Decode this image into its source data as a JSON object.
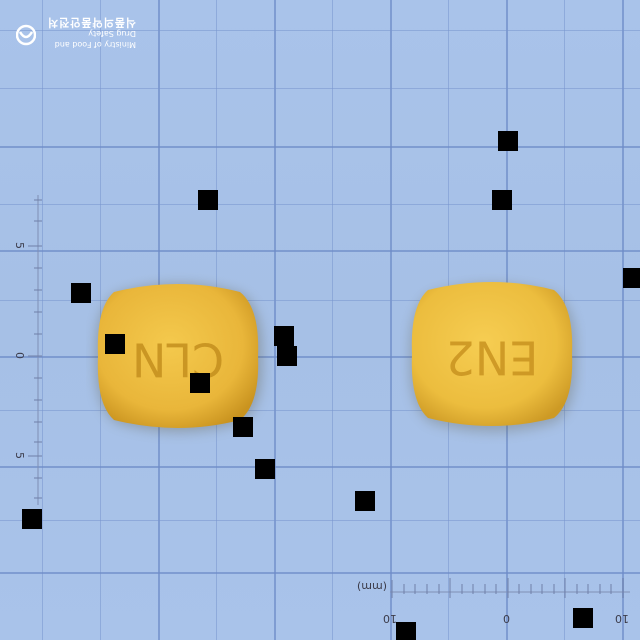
{
  "logo": {
    "agency_english": "Ministry of Food and Drug Safety",
    "agency_korean": "식품의약품안전처"
  },
  "ruler_vertical": {
    "labels": [
      "5",
      "0",
      "5"
    ]
  },
  "ruler_horizontal": {
    "unit_label": "(mm)",
    "labels": [
      "10",
      "0",
      "10"
    ]
  },
  "pills": [
    {
      "imprint": "CLN",
      "color": "#e9b63a"
    },
    {
      "imprint": "EN2",
      "color": "#ecbd3e"
    }
  ],
  "occlusion_color": "#000000"
}
